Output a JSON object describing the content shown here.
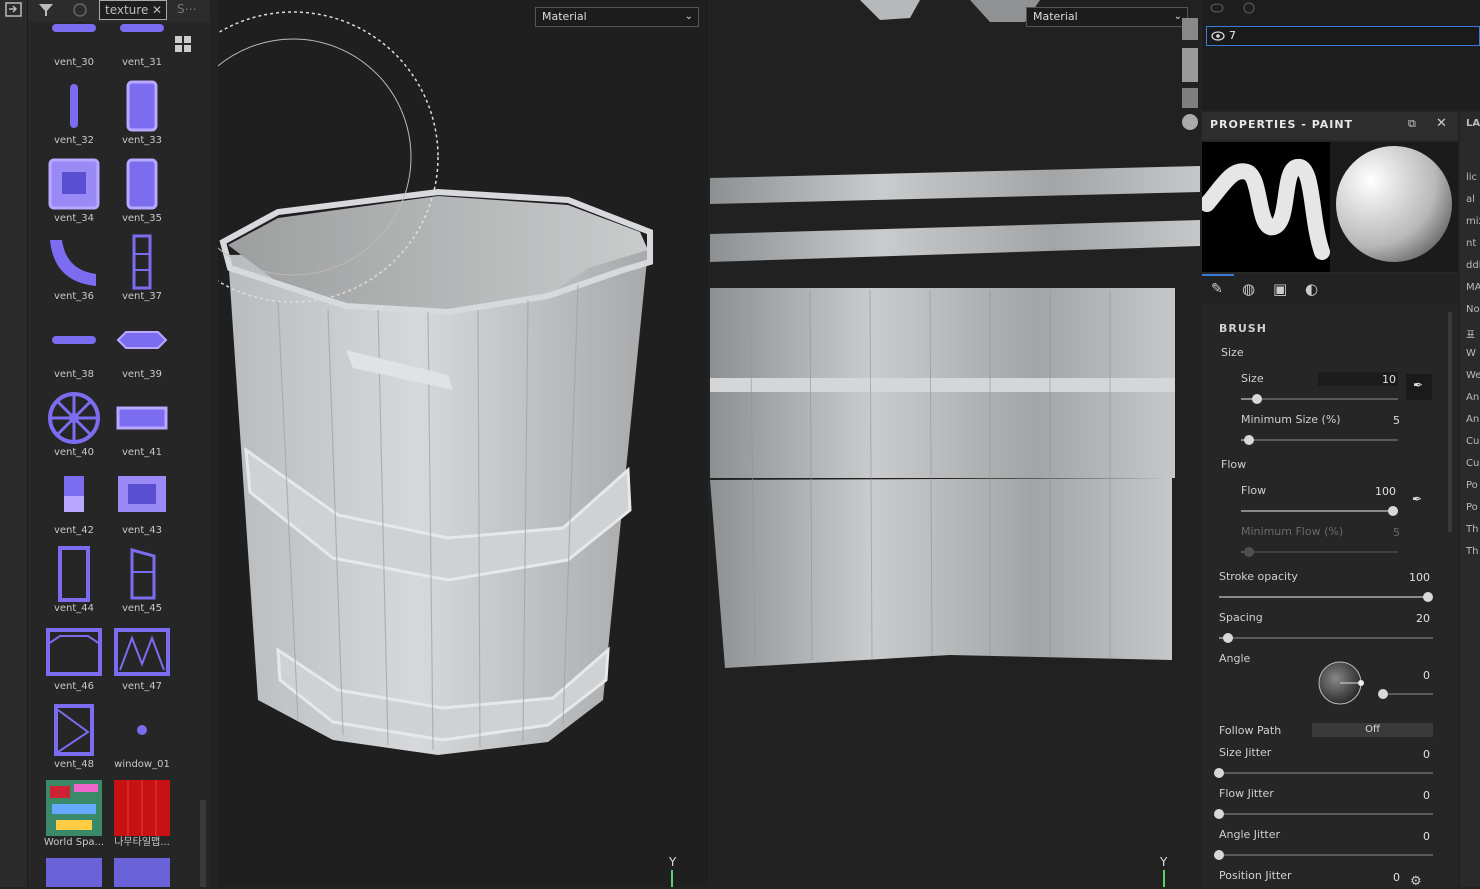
{
  "shelf": {
    "tabs": [
      "texture",
      "S"
    ],
    "items": [
      {
        "label": "vent_30",
        "kind": "bar"
      },
      {
        "label": "vent_31",
        "kind": "bar"
      },
      {
        "label": "vent_32",
        "kind": "thin"
      },
      {
        "label": "vent_33",
        "kind": "tall"
      },
      {
        "label": "vent_34",
        "kind": "square"
      },
      {
        "label": "vent_35",
        "kind": "tall"
      },
      {
        "label": "vent_36",
        "kind": "curve"
      },
      {
        "label": "vent_37",
        "kind": "ladder"
      },
      {
        "label": "vent_38",
        "kind": "bar"
      },
      {
        "label": "vent_39",
        "kind": "hex"
      },
      {
        "label": "vent_40",
        "kind": "wheel"
      },
      {
        "label": "vent_41",
        "kind": "rect"
      },
      {
        "label": "vent_42",
        "kind": "small"
      },
      {
        "label": "vent_43",
        "kind": "box"
      },
      {
        "label": "vent_44",
        "kind": "frame"
      },
      {
        "label": "vent_45",
        "kind": "door"
      },
      {
        "label": "vent_46",
        "kind": "window"
      },
      {
        "label": "vent_47",
        "kind": "zigzag"
      },
      {
        "label": "vent_48",
        "kind": "tri"
      },
      {
        "label": "window_01",
        "kind": "dot"
      },
      {
        "label": "World Spa...",
        "kind": "map"
      },
      {
        "label": "나무타일맵...",
        "kind": "red"
      },
      {
        "label": "",
        "kind": "tile"
      },
      {
        "label": "",
        "kind": "tile"
      }
    ]
  },
  "viewport3d": {
    "material_select": "Material",
    "axis": "Y"
  },
  "viewport2d": {
    "material_select": "Material",
    "axis": "Y"
  },
  "layers": {
    "active_layer": "7"
  },
  "properties": {
    "title": "PROPERTIES - PAINT",
    "section": "BRUSH",
    "size_group": "Size",
    "size": {
      "label": "Size",
      "value": "10",
      "fraction": 0.1
    },
    "min_size": {
      "label": "Minimum Size (%)",
      "value": "5",
      "fraction": 0.05
    },
    "flow_group": "Flow",
    "flow": {
      "label": "Flow",
      "value": "100",
      "fraction": 1.0
    },
    "min_flow": {
      "label": "Minimum Flow (%)",
      "value": "5",
      "fraction": 0.05
    },
    "stroke_opacity": {
      "label": "Stroke opacity",
      "value": "100",
      "fraction": 1.0
    },
    "spacing": {
      "label": "Spacing",
      "value": "20",
      "fraction": 0.04
    },
    "angle": {
      "label": "Angle",
      "value": "0",
      "fraction": 0.0
    },
    "follow_path": {
      "label": "Follow Path",
      "value": "Off"
    },
    "size_jitter": {
      "label": "Size Jitter",
      "value": "0",
      "fraction": 0.0
    },
    "flow_jitter": {
      "label": "Flow Jitter",
      "value": "0",
      "fraction": 0.0
    },
    "angle_jitter": {
      "label": "Angle Jitter",
      "value": "0",
      "fraction": 0.0
    },
    "position_jitter": {
      "label": "Position Jitter",
      "value": "0"
    }
  },
  "far_right": {
    "tab": "LA",
    "items": [
      "lic",
      "al",
      "mix",
      "nt o",
      "ddi",
      "MA",
      "No",
      "표",
      "W",
      "We",
      "An",
      "An",
      "Cu",
      "Cu",
      "Po",
      "Po",
      "Th",
      "Th"
    ]
  },
  "colors": {
    "accent": "#3a7bd5",
    "vent": "#7b6cf0"
  }
}
